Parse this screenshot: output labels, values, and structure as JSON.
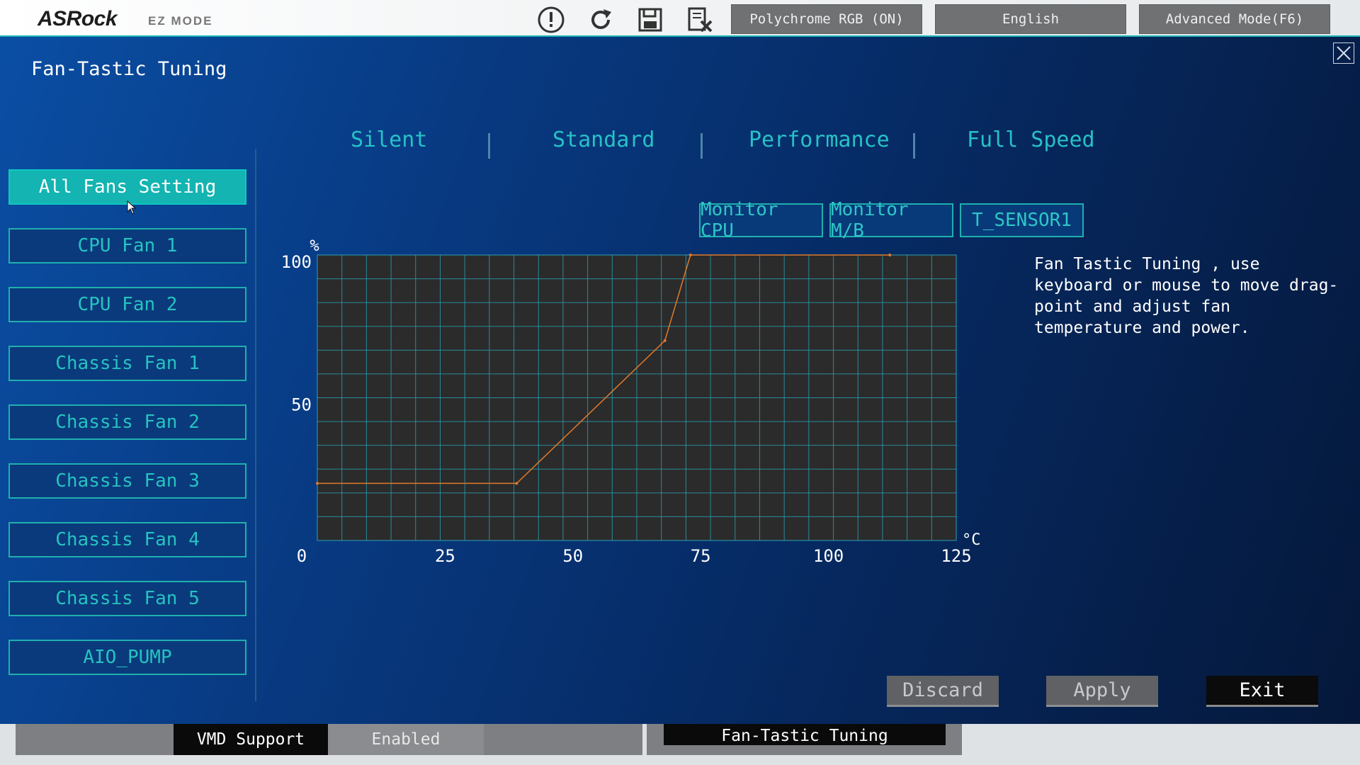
{
  "topbar": {
    "brand": "ASRock",
    "mode": "EZ MODE",
    "icons": [
      "alert-icon",
      "refresh-icon",
      "save-icon",
      "discard-exit-icon"
    ],
    "polychrome_label": "Polychrome RGB (ON)",
    "language_label": "English",
    "advanced_label": "Advanced Mode(F6)"
  },
  "panel": {
    "title": "Fan-Tastic Tuning"
  },
  "fans": [
    {
      "label": "All Fans Setting",
      "active": true
    },
    {
      "label": "CPU Fan 1",
      "active": false
    },
    {
      "label": "CPU Fan 2",
      "active": false
    },
    {
      "label": "Chassis Fan 1",
      "active": false
    },
    {
      "label": "Chassis Fan 2",
      "active": false
    },
    {
      "label": "Chassis Fan 3",
      "active": false
    },
    {
      "label": "Chassis Fan 4",
      "active": false
    },
    {
      "label": "Chassis Fan 5",
      "active": false
    },
    {
      "label": "AIO_PUMP",
      "active": false
    }
  ],
  "presets": [
    "Silent",
    "Standard",
    "Performance",
    "Full Speed"
  ],
  "monitor_buttons": [
    "Monitor CPU",
    "Monitor M/B",
    "T_SENSOR1"
  ],
  "help_text": "Fan Tastic Tuning , use keyboard or mouse to move drag-point and adjust fan temperature and power.",
  "chart_data": {
    "type": "line",
    "x": [
      0,
      39,
      68,
      73,
      112
    ],
    "series": [
      {
        "values": [
          20,
          20,
          70,
          100,
          100
        ]
      }
    ],
    "xlabel": "°C",
    "ylabel": "%",
    "x_ticks": [
      "0",
      "25",
      "50",
      "75",
      "100",
      "125"
    ],
    "y_ticks": [
      "100",
      "50"
    ],
    "xlim": [
      0,
      125
    ],
    "ylim": [
      0,
      100
    ],
    "grid": true,
    "colors": {
      "line": "#e07a2a",
      "grid": "#2aa2b6",
      "plot_bg": "#2b2b2b"
    }
  },
  "actions": {
    "discard": "Discard",
    "apply": "Apply",
    "exit": "Exit"
  },
  "bottom_strip": {
    "vmd_label": "VMD Support",
    "vmd_value": "Enabled",
    "fan_tab_label": "Fan-Tastic Tuning"
  }
}
